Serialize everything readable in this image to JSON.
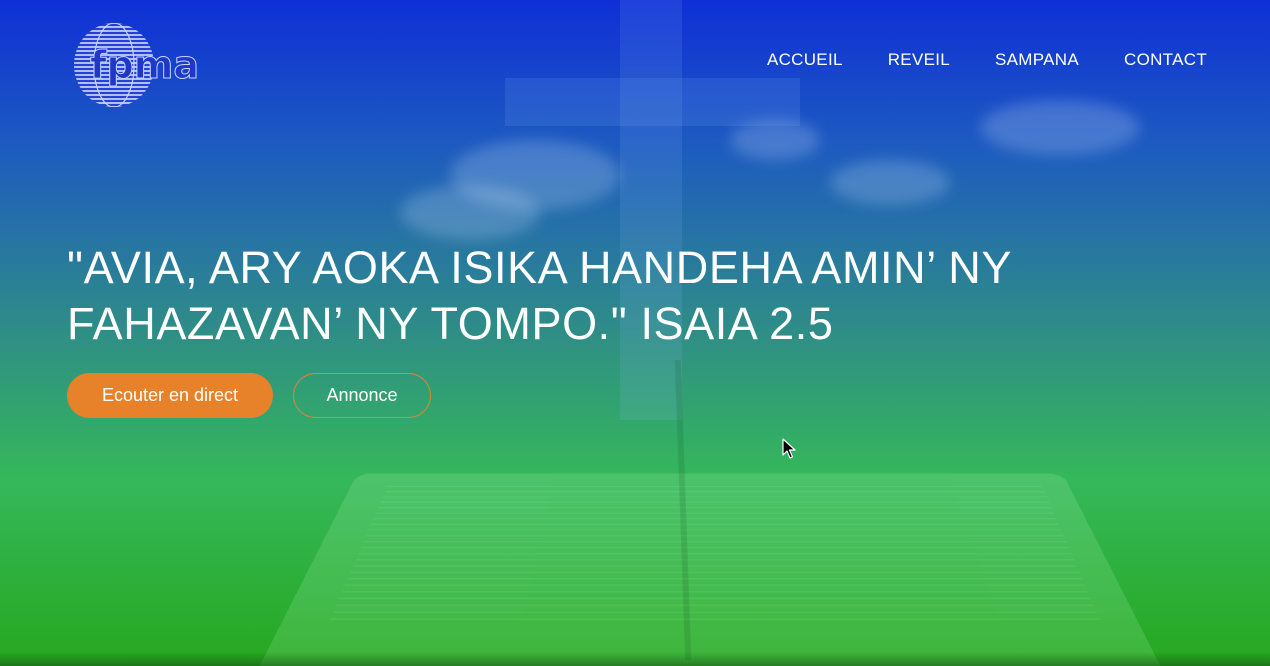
{
  "logo": {
    "text": "fpma",
    "icon": "fpma-globe-logo"
  },
  "nav": {
    "items": [
      {
        "label": "ACCUEIL"
      },
      {
        "label": "REVEIL"
      },
      {
        "label": "SAMPANA"
      },
      {
        "label": "CONTACT"
      }
    ]
  },
  "hero": {
    "verse": "\"AVIA, ARY AOKA ISIKA HANDEHA AMIN’ NY FAHAZAVAN’ NY TOMPO.\" ISAIA 2.5",
    "primary_button": "Ecouter en direct",
    "secondary_button": "Annonce"
  },
  "colors": {
    "accent": "#e8822a",
    "gradient_top": "#0f2fd6",
    "gradient_bottom": "#26a81f",
    "text": "#ffffff"
  },
  "icons": {
    "cursor": "mouse-pointer-icon"
  }
}
